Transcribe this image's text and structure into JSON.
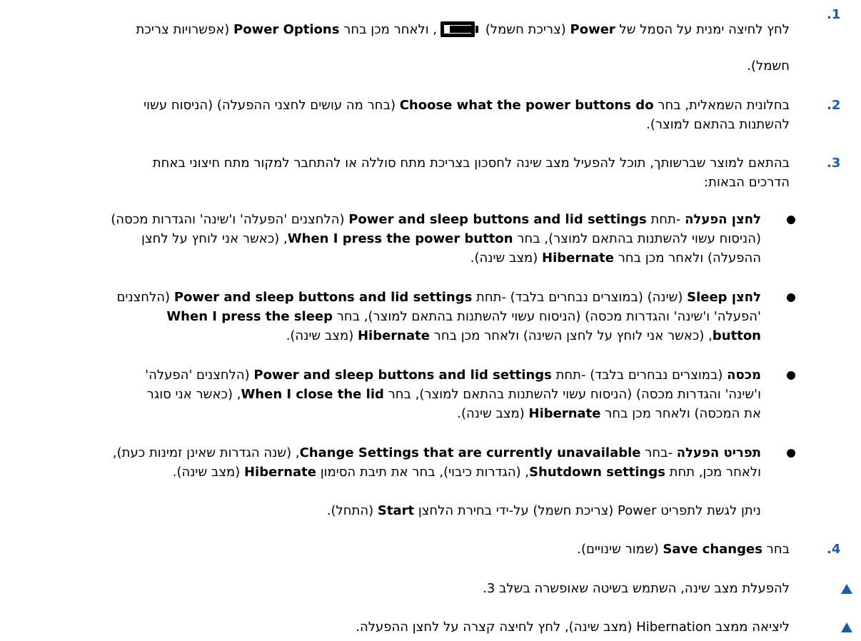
{
  "step1": {
    "number": ".1",
    "l1_a": "לחץ לחיצה ימנית על הסמל של ",
    "l1_b": "Power",
    "l1_c": " (צריכת חשמל) ",
    "l1_d": ", ולאחר מכן בחר ",
    "l1_e": "Power Options",
    "l1_f": " (אפשרויות צריכת",
    "l2": "חשמל)."
  },
  "step2": {
    "number": ".2",
    "l1_a": "בחלונית השמאלית, בחר ",
    "l1_b": "Choose what the power buttons do",
    "l1_c": " (בחר מה עושים לחצני ההפעלה) (הניסוח עשוי",
    "l2": "להשתנות בהתאם למוצר)."
  },
  "step3": {
    "number": ".3",
    "l1": "בהתאם למוצר שברשותך, תוכל להפעיל מצב שינה לחסכון בצריכת מתח סוללה או להתחבר למקור מתח חיצוני באחת",
    "l2": "הדרכים הבאות:"
  },
  "bullet1": {
    "l1_a": "לחצן הפעלה",
    "l1_b": " -תחת ",
    "l1_c": "Power and sleep buttons and lid settings",
    "l1_d": " (הלחצנים 'הפעלה' ו'שינה' והגדרות מכסה)",
    "l2_a": "(הניסוח עשוי להשתנות בהתאם למוצר), בחר ",
    "l2_b": "When I press the power button",
    "l2_c": ", (כאשר אני לוחץ על לחצן",
    "l3_a": "ההפעלה) ולאחר מכן בחר ",
    "l3_b": "Hibernate",
    "l3_c": " (מצב שינה)."
  },
  "bullet2": {
    "l1_a": "לחצן Sleep",
    "l1_b": " (שינה) (במוצרים נבחרים בלבד) -תחת ",
    "l1_c": "Power and sleep buttons and lid settings",
    "l1_d": " (הלחצנים",
    "l2_a": "'הפעלה' ו'שינה' והגדרות מכסה) (הניסוח עשוי להשתנות בהתאם למוצר), בחר ",
    "l2_b": "When I press the sleep",
    "l3_a": "button",
    "l3_b": ", (כאשר אני לוחץ על לחצן השינה) ולאחר מכן בחר ",
    "l3_c": "Hibernate",
    "l3_d": " (מצב שינה)."
  },
  "bullet3": {
    "l1_a": "מכסה",
    "l1_b": " (במוצרים נבחרים בלבד) -תחת ",
    "l1_c": "Power and sleep buttons and lid settings",
    "l1_d": " (הלחצנים 'הפעלה'",
    "l2_a": "ו'שינה' והגדרות מכסה) (הניסוח עשוי להשתנות בהתאם למוצר), בחר ",
    "l2_b": "When I close the lid",
    "l2_c": ", (כאשר אני סוגר",
    "l3_a": "את המכסה) ולאחר מכן בחר ",
    "l3_b": "Hibernate",
    "l3_c": " (מצב שינה)."
  },
  "bullet4": {
    "l1_a": "תפריט הפעלה",
    "l1_b": " -בחר ",
    "l1_c": "Change Settings that are currently unavailable",
    "l1_d": ", (שנה הגדרות שאינן זמינות כעת),",
    "l2_a": "ולאחר מכן, תחת ",
    "l2_b": "Shutdown settings",
    "l2_c": ", (הגדרות כיבוי), בחר את תיבת הסימון ",
    "l2_d": "Hibernate",
    "l2_e": " (מצב שינה)."
  },
  "note": {
    "a": "ניתן לגשת לתפריט Power (צריכת חשמל) על-ידי בחירת הלחצן ",
    "b": "Start",
    "c": " (התחל)."
  },
  "step4": {
    "number": ".4",
    "a": "בחר ",
    "b": "Save changes",
    "c": " (שמור שינויים)."
  },
  "tips": [
    "להפעלת מצב שינה, השתמש בשיטה שאופשרה בשלב 3.",
    "ליציאה ממצב Hibernation (מצב שינה), לחץ לחיצה קצרה על לחצן ההפעלה."
  ],
  "icon": "battery-icon",
  "accent_color": "#1a5ea8"
}
